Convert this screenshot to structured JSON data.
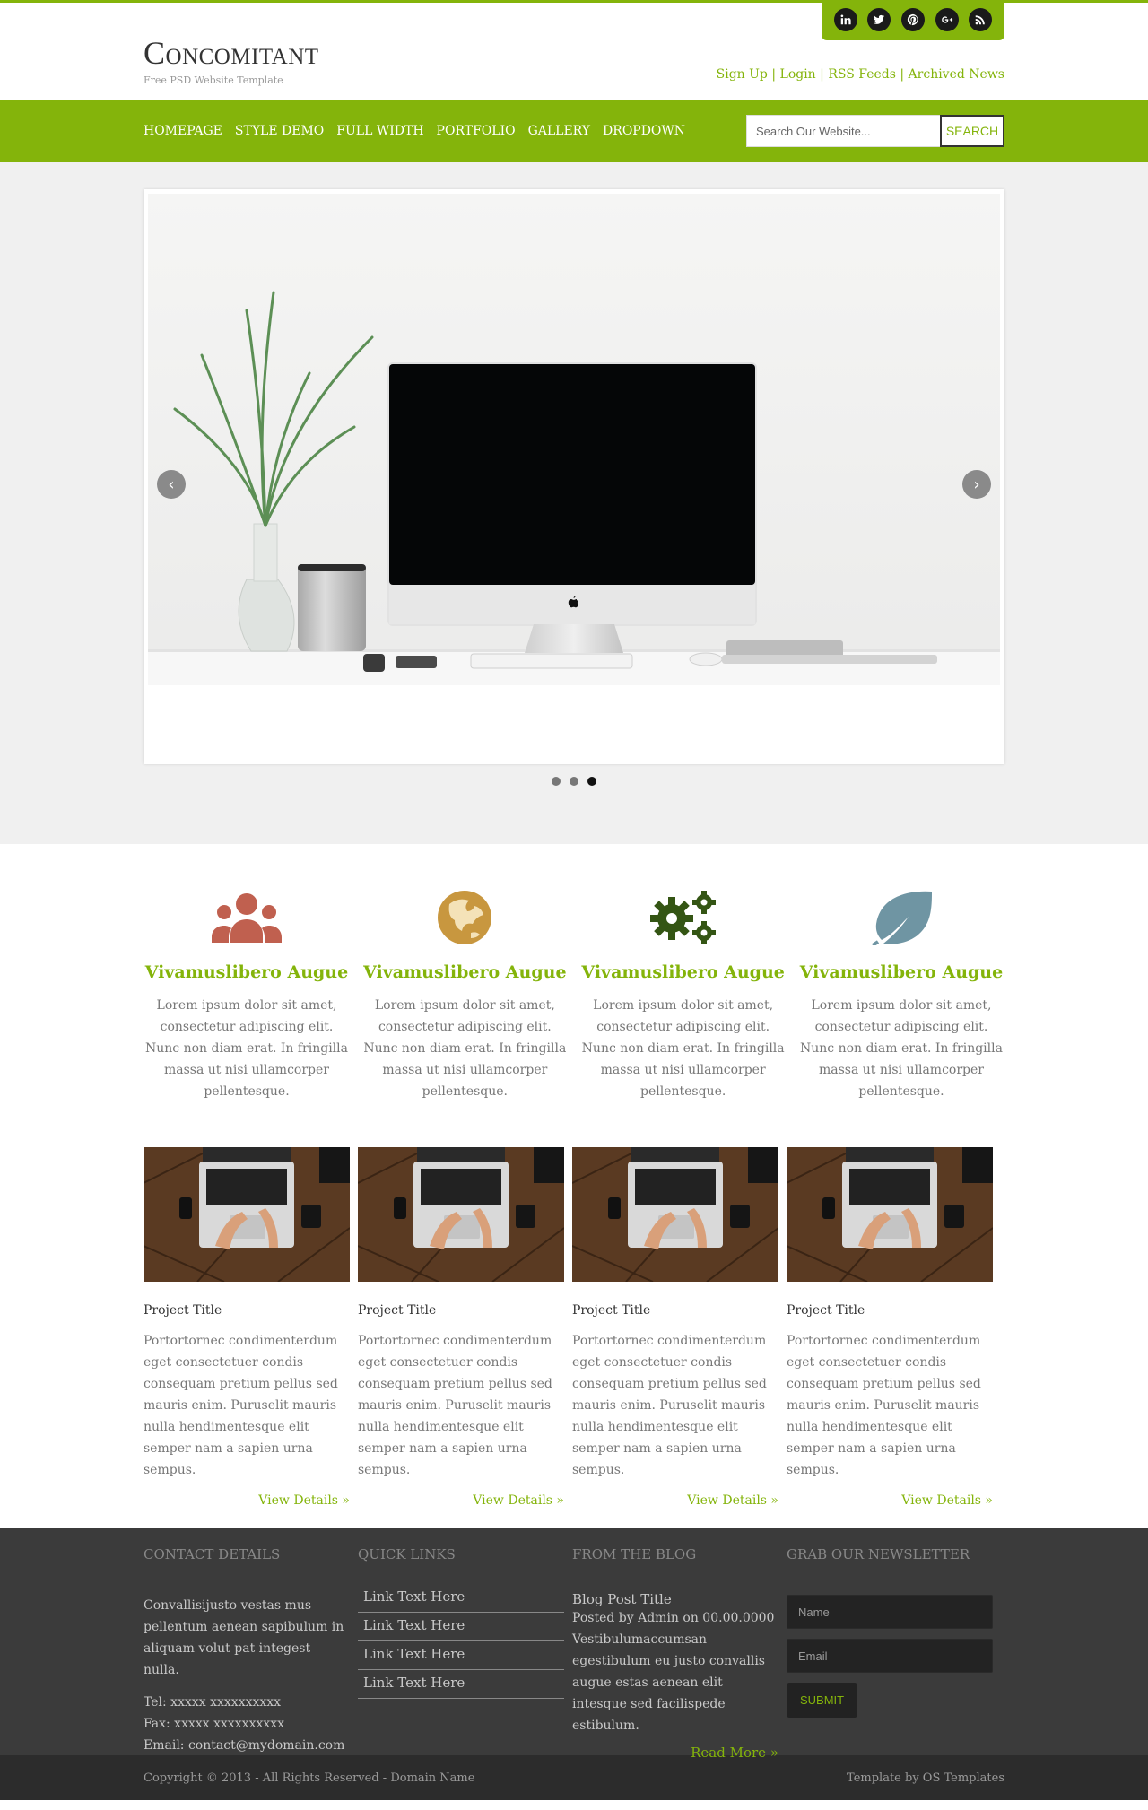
{
  "brand": {
    "title": "Concomitant",
    "tagline": "Free PSD Website Template",
    "accent_color": "#84b40b"
  },
  "social": [
    {
      "icon": "linkedin-icon",
      "label": "in"
    },
    {
      "icon": "twitter-icon",
      "label": "tw"
    },
    {
      "icon": "pinterest-icon",
      "label": "p"
    },
    {
      "icon": "google-plus-icon",
      "label": "g+"
    },
    {
      "icon": "rss-icon",
      "label": "rss"
    }
  ],
  "header_links": [
    "Sign Up",
    "Login",
    "RSS Feeds",
    "Archived News"
  ],
  "nav": [
    "HOMEPAGE",
    "STYLE DEMO",
    "FULL WIDTH",
    "PORTFOLIO",
    "GALLERY",
    "DROPDOWN"
  ],
  "search": {
    "placeholder": "Search Our Website...",
    "button": "SEARCH"
  },
  "slider": {
    "dots": 3,
    "active_dot": 3,
    "prev_icon": "chevron-left-icon",
    "next_icon": "chevron-right-icon"
  },
  "features": [
    {
      "icon": "users-icon",
      "color": "#c0604f",
      "title": "Vivamuslibero Augue",
      "text": "Lorem ipsum dolor sit amet, consectetur adipiscing elit. Nunc non diam erat. In fringilla massa ut nisi ullamcorper pellentesque."
    },
    {
      "icon": "globe-icon",
      "color": "#c8973f",
      "title": "Vivamuslibero Augue",
      "text": "Lorem ipsum dolor sit amet, consectetur adipiscing elit. Nunc non diam erat. In fringilla massa ut nisi ullamcorper pellentesque."
    },
    {
      "icon": "gears-icon",
      "color": "#345514",
      "title": "Vivamuslibero Augue",
      "text": "Lorem ipsum dolor sit amet, consectetur adipiscing elit. Nunc non diam erat. In fringilla massa ut nisi ullamcorper pellentesque."
    },
    {
      "icon": "leaf-icon",
      "color": "#6f95a3",
      "title": "Vivamuslibero Augue",
      "text": "Lorem ipsum dolor sit amet, consectetur adipiscing elit. Nunc non diam erat. In fringilla massa ut nisi ullamcorper pellentesque."
    }
  ],
  "projects": [
    {
      "title": "Project Title",
      "text": "Portortornec condimenterdum eget consectetuer condis consequam pretium pellus sed mauris enim. Puruselit mauris nulla hendimentesque elit semper nam a sapien urna sempus.",
      "link": "View Details »"
    },
    {
      "title": "Project Title",
      "text": "Portortornec condimenterdum eget consectetuer condis consequam pretium pellus sed mauris enim. Puruselit mauris nulla hendimentesque elit semper nam a sapien urna sempus.",
      "link": "View Details »"
    },
    {
      "title": "Project Title",
      "text": "Portortornec condimenterdum eget consectetuer condis consequam pretium pellus sed mauris enim. Puruselit mauris nulla hendimentesque elit semper nam a sapien urna sempus.",
      "link": "View Details »"
    },
    {
      "title": "Project Title",
      "text": "Portortornec condimenterdum eget consectetuer condis consequam pretium pellus sed mauris enim. Puruselit mauris nulla hendimentesque elit semper nam a sapien urna sempus.",
      "link": "View Details »"
    }
  ],
  "footer": {
    "contact": {
      "heading": "CONTACT DETAILS",
      "text": "Convallisijusto vestas mus pellentum aenean sapibulum in aliquam volut pat integest nulla.",
      "tel": "Tel: xxxxx xxxxxxxxxx",
      "fax": "Fax: xxxxx xxxxxxxxxx",
      "email": "Email: contact@mydomain.com"
    },
    "quick_links": {
      "heading": "QUICK LINKS",
      "links": [
        "Link Text Here",
        "Link Text Here",
        "Link Text Here",
        "Link Text Here"
      ]
    },
    "blog": {
      "heading": "FROM THE BLOG",
      "post_title": "Blog Post Title",
      "meta": "Posted by Admin on 00.00.0000",
      "excerpt": "Vestibulumaccumsan egestibulum eu justo convallis augue estas aenean elit intesque sed facilispede estibulum.",
      "more": "Read More »"
    },
    "newsletter": {
      "heading": "GRAB OUR NEWSLETTER",
      "name_placeholder": "Name",
      "email_placeholder": "Email",
      "submit": "SUBMIT"
    }
  },
  "copyright": {
    "left": "Copyright © 2013 - All Rights Reserved - Domain Name",
    "right": "Template by OS Templates"
  }
}
